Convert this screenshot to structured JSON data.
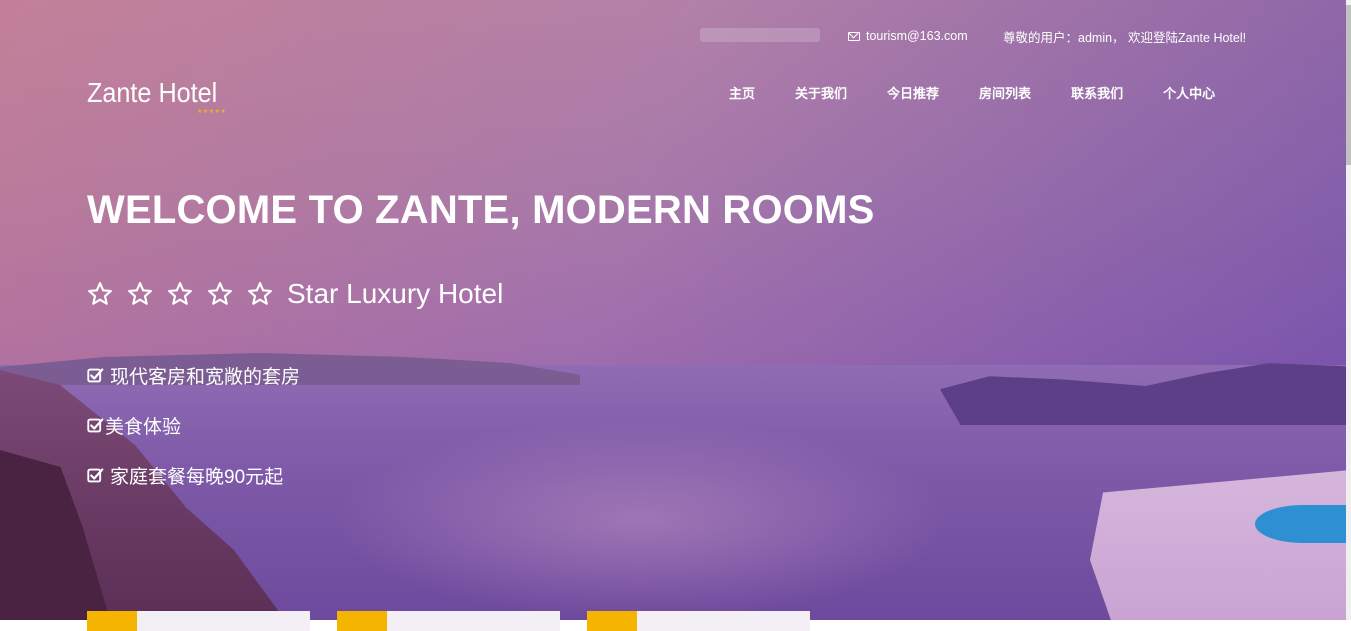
{
  "topbar": {
    "email": "tourism@163.com",
    "user_greeting": "尊敬的用户：admin，  欢迎登陆Zante Hotel!"
  },
  "logo": {
    "name": "Zante Hotel",
    "stars": "★★★★★"
  },
  "nav": {
    "items": [
      {
        "label": "主页"
      },
      {
        "label": "关于我们"
      },
      {
        "label": "今日推荐"
      },
      {
        "label": "房间列表"
      },
      {
        "label": "联系我们"
      },
      {
        "label": "个人中心"
      }
    ]
  },
  "hero": {
    "title": "WELCOME TO ZANTE, MODERN ROOMS",
    "rating_stars": 5,
    "rating_text": "Star Luxury Hotel",
    "features": [
      {
        "label": "现代客房和宽敞的套房"
      },
      {
        "label": "美食体验"
      },
      {
        "label": "家庭套餐每晚90元起"
      }
    ]
  },
  "colors": {
    "accent": "#f4b400",
    "logo_stars": "#f2b01e",
    "overlay_left": "#cd788c",
    "overlay_right": "#5a3caa"
  },
  "icons": {
    "email": "mail-icon",
    "rating_star": "star-outline-icon",
    "feature_check": "checkbox-checked-icon"
  }
}
